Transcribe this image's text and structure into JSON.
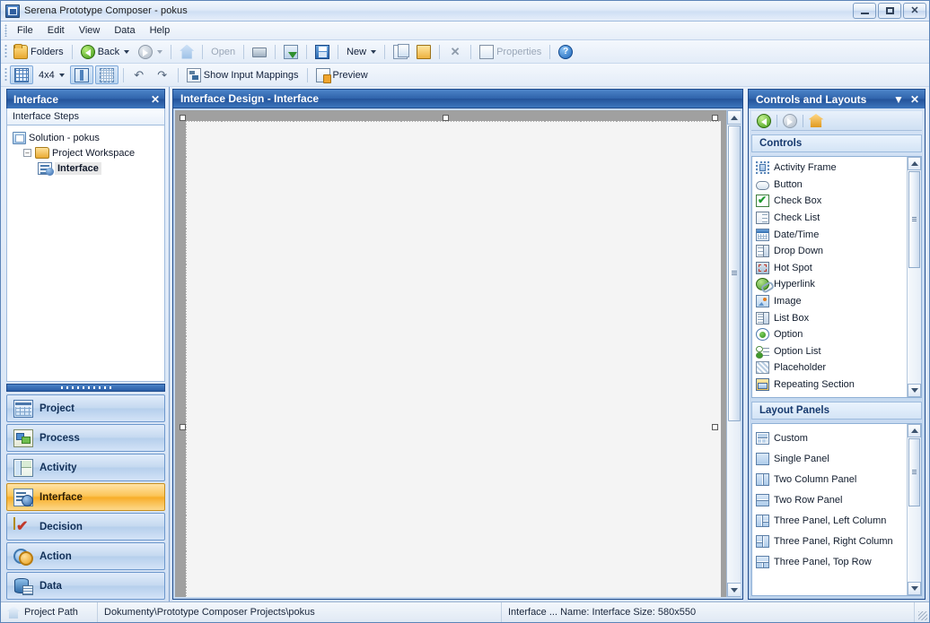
{
  "window": {
    "title": "Serena Prototype Composer - pokus",
    "app_icon": "app-icon",
    "minimize": "–",
    "maximize": "□",
    "close": "✕"
  },
  "menu": {
    "items": [
      {
        "label": "File"
      },
      {
        "label": "Edit"
      },
      {
        "label": "View"
      },
      {
        "label": "Data"
      },
      {
        "label": "Help"
      }
    ]
  },
  "toolbar_main": {
    "items": [
      {
        "label": "Folders",
        "icon": "folder-icon",
        "type": "button"
      },
      {
        "label": "Back",
        "icon": "back-arrow-icon",
        "type": "dropdown-button"
      },
      {
        "label": "",
        "icon": "forward-arrow-icon",
        "type": "dropdown-button",
        "disabled": true
      },
      {
        "label": "",
        "icon": "home-icon",
        "type": "button"
      },
      {
        "label": "Open",
        "icon": "open-icon",
        "type": "button",
        "disabled": true
      },
      {
        "label": "",
        "icon": "print-icon",
        "type": "button"
      },
      {
        "label": "",
        "icon": "import-icon",
        "type": "button"
      },
      {
        "label": "",
        "icon": "save-icon",
        "type": "button"
      },
      {
        "label": "New",
        "icon": "new-icon",
        "type": "dropdown-button"
      },
      {
        "label": "",
        "icon": "copy-icon",
        "type": "button"
      },
      {
        "label": "",
        "icon": "open-folder-icon",
        "type": "button"
      },
      {
        "label": "",
        "icon": "delete-x-icon",
        "type": "button",
        "disabled": true
      },
      {
        "label": "Properties",
        "icon": "properties-icon",
        "type": "button",
        "disabled": true
      },
      {
        "label": "",
        "icon": "help-icon",
        "type": "button"
      }
    ]
  },
  "toolbar_design": {
    "grid_icon": "grid-icon",
    "grid_size": "4x4",
    "snap_vertical_icon": "snap-to-guide-icon",
    "snap_grid_icon": "snap-to-grid-icon",
    "undo_icon": "undo-icon",
    "redo_icon": "redo-icon",
    "show_input_mappings": "Show Input Mappings",
    "show_input_mappings_icon": "input-mappings-icon",
    "preview": "Preview",
    "preview_icon": "preview-icon"
  },
  "left_panel": {
    "title": "Interface",
    "close_label": "✕",
    "subheader": "Interface Steps",
    "tree": [
      {
        "label": "Solution - pokus",
        "level": 1,
        "icon": "solution-icon",
        "expander": "",
        "selected": false
      },
      {
        "label": "Project Workspace",
        "level": 2,
        "icon": "folder-icon",
        "expander": "–",
        "selected": false
      },
      {
        "label": "Interface",
        "level": 3,
        "icon": "interface-step-icon",
        "expander": "",
        "selected": true
      }
    ],
    "nav_buttons": [
      {
        "label": "Project",
        "icon": "project-icon",
        "active": false
      },
      {
        "label": "Process",
        "icon": "process-icon",
        "active": false
      },
      {
        "label": "Activity",
        "icon": "activity-icon",
        "active": false
      },
      {
        "label": "Interface",
        "icon": "interface-icon",
        "active": true
      },
      {
        "label": "Decision",
        "icon": "decision-icon",
        "active": false
      },
      {
        "label": "Action",
        "icon": "action-icon",
        "active": false
      },
      {
        "label": "Data",
        "icon": "data-icon",
        "active": false
      }
    ]
  },
  "design_panel": {
    "title": "Interface Design - Interface",
    "canvas_size": "580x550",
    "grid_spacing_px": 40
  },
  "right_panel": {
    "title": "Controls and Layouts",
    "collapse_label": "▼",
    "close_label": "✕",
    "nav": {
      "back_icon": "back-arrow-icon",
      "forward_icon": "forward-arrow-icon",
      "home_icon": "home-icon"
    },
    "controls_section": {
      "header": "Controls",
      "items": [
        {
          "label": "Activity Frame",
          "icon": "activity-frame-icon"
        },
        {
          "label": "Button",
          "icon": "button-icon"
        },
        {
          "label": "Check Box",
          "icon": "check-box-icon"
        },
        {
          "label": "Check List",
          "icon": "check-list-icon"
        },
        {
          "label": "Date/Time",
          "icon": "date-time-icon"
        },
        {
          "label": "Drop Down",
          "icon": "drop-down-icon"
        },
        {
          "label": "Hot Spot",
          "icon": "hot-spot-icon"
        },
        {
          "label": "Hyperlink",
          "icon": "hyperlink-icon"
        },
        {
          "label": "Image",
          "icon": "image-icon"
        },
        {
          "label": "List Box",
          "icon": "list-box-icon"
        },
        {
          "label": "Option",
          "icon": "option-icon"
        },
        {
          "label": "Option List",
          "icon": "option-list-icon"
        },
        {
          "label": "Placeholder",
          "icon": "placeholder-icon"
        },
        {
          "label": "Repeating Section",
          "icon": "repeating-section-icon"
        }
      ]
    },
    "layouts_section": {
      "header": "Layout Panels",
      "items": [
        {
          "label": "Custom",
          "icon": "custom-layout-icon"
        },
        {
          "label": "Single Panel",
          "icon": "single-panel-icon"
        },
        {
          "label": "Two Column Panel",
          "icon": "two-column-panel-icon"
        },
        {
          "label": "Two Row Panel",
          "icon": "two-row-panel-icon"
        },
        {
          "label": "Three Panel, Left Column",
          "icon": "three-panel-left-icon"
        },
        {
          "label": "Three Panel, Right Column",
          "icon": "three-panel-right-icon"
        },
        {
          "label": "Three Panel, Top Row",
          "icon": "three-panel-top-icon"
        }
      ]
    }
  },
  "statusbar": {
    "project_path_label": "Project Path",
    "project_path_icon": "home-icon",
    "project_path_value": "Dokumenty\\Prototype Composer Projects\\pokus",
    "selection_info": "Interface ...  Name: Interface  Size: 580x550"
  },
  "colors": {
    "caption_blue": "#2f63ab",
    "active_nav_orange": "#f8ae2a",
    "panel_bg": "#d3e2f5",
    "canvas_gray": "#a0a0a0",
    "canvas_white": "#f4f4f4"
  }
}
